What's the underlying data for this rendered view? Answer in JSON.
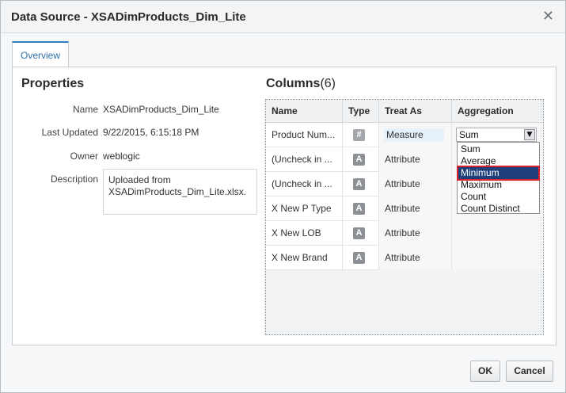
{
  "dialog": {
    "title": "Data Source - XSADimProducts_Dim_Lite",
    "close_glyph": "✕"
  },
  "tabs": [
    {
      "label": "Overview"
    }
  ],
  "properties": {
    "heading": "Properties",
    "name_label": "Name",
    "name_value": "XSADimProducts_Dim_Lite",
    "updated_label": "Last Updated",
    "updated_value": "9/22/2015, 6:15:18 PM",
    "owner_label": "Owner",
    "owner_value": "weblogic",
    "description_label": "Description",
    "description_line1": "Uploaded from",
    "description_line2": "XSADimProducts_Dim_Lite.xlsx."
  },
  "columns": {
    "heading": "Columns",
    "count": "(6)",
    "headers": {
      "name": "Name",
      "type": "Type",
      "treat_as": "Treat As",
      "aggregation": "Aggregation"
    },
    "rows": [
      {
        "name": "Product Num...",
        "type_glyph": "#",
        "treat_as": "Measure",
        "aggregation": "Sum"
      },
      {
        "name": "(Uncheck in ...",
        "type_glyph": "A",
        "treat_as": "Attribute",
        "aggregation": ""
      },
      {
        "name": "(Uncheck in ...",
        "type_glyph": "A",
        "treat_as": "Attribute",
        "aggregation": ""
      },
      {
        "name": "X New P Type",
        "type_glyph": "A",
        "treat_as": "Attribute",
        "aggregation": ""
      },
      {
        "name": "X New LOB",
        "type_glyph": "A",
        "treat_as": "Attribute",
        "aggregation": ""
      },
      {
        "name": "X New Brand",
        "type_glyph": "A",
        "treat_as": "Attribute",
        "aggregation": ""
      }
    ],
    "aggregation_dropdown": {
      "selected_display": "Sum",
      "arrow_glyph": "▼",
      "options": [
        "Sum",
        "Average",
        "Minimum",
        "Maximum",
        "Count",
        "Count Distinct"
      ],
      "highlighted": "Minimum"
    }
  },
  "footer": {
    "ok_label": "OK",
    "cancel_label": "Cancel"
  },
  "colors": {
    "accent": "#2f7fc1",
    "selection": "#1e3f7a",
    "highlight_outline": "#d8212a"
  }
}
